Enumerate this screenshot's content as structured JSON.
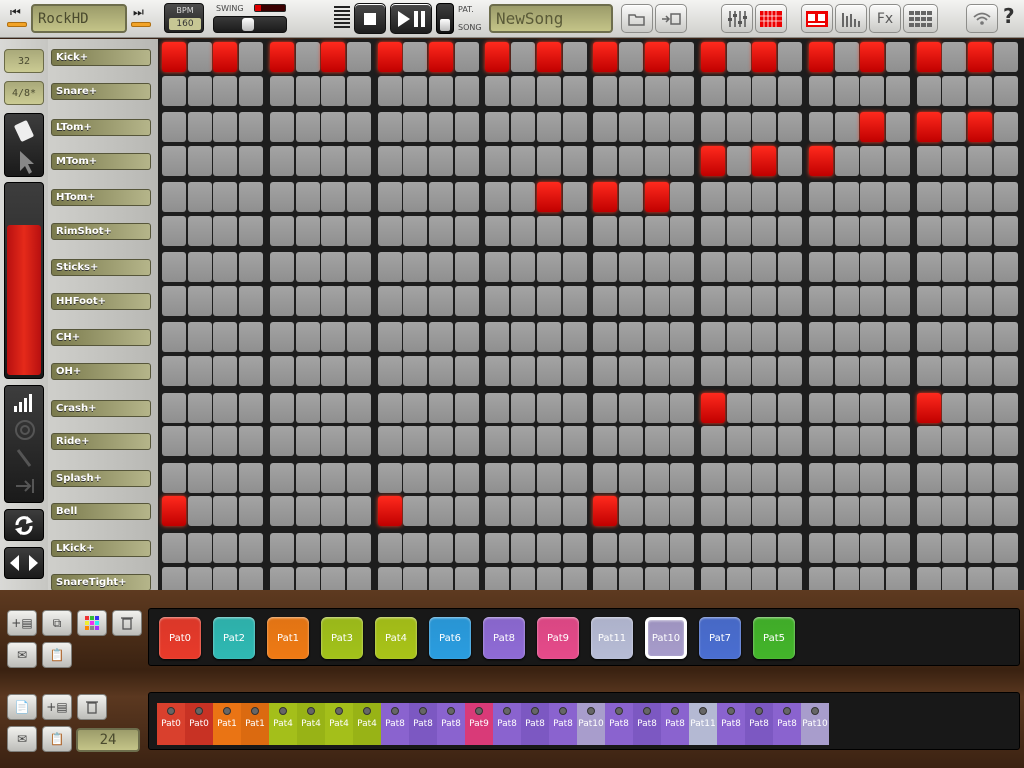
{
  "song_name": "RockHD",
  "bpm_label": "BPM",
  "bpm_value": "160",
  "swing_label": "SWING",
  "pat_label": "PAT.",
  "song_label": "SONG",
  "pattern_name": "NewSong",
  "steps_value": "32",
  "time_signature": "4/8*",
  "song_length": "24",
  "help_label": "?",
  "fx_label": "Fx",
  "instruments": [
    "Kick+",
    "Snare+",
    "LTom+",
    "MTom+",
    "HTom+",
    "RimShot+",
    "Sticks+",
    "HHFoot+",
    "CH+",
    "OH+",
    "Crash+",
    "Ride+",
    "Splash+",
    "Bell",
    "LKick+",
    "SnareTight+"
  ],
  "active_steps": [
    [
      0,
      2,
      4,
      6,
      8,
      10,
      12,
      14,
      16,
      18,
      20,
      22,
      24,
      26,
      28,
      30
    ],
    [],
    [
      26,
      28,
      30
    ],
    [
      20,
      22,
      24
    ],
    [
      14,
      16,
      18
    ],
    [],
    [],
    [],
    [],
    [],
    [
      20,
      28
    ],
    [],
    [],
    [
      0,
      8,
      16
    ],
    [],
    []
  ],
  "patterns": [
    {
      "label": "Pat0",
      "color": "#e83a2a"
    },
    {
      "label": "Pat2",
      "color": "#2fb9b3"
    },
    {
      "label": "Pat1",
      "color": "#ef7a14"
    },
    {
      "label": "Pat3",
      "color": "#a2c21a"
    },
    {
      "label": "Pat4",
      "color": "#a9c418"
    },
    {
      "label": "Pat6",
      "color": "#2a9de0"
    },
    {
      "label": "Pat8",
      "color": "#8f6bd6"
    },
    {
      "label": "Pat9",
      "color": "#e64a8a"
    },
    {
      "label": "Pat11",
      "color": "#b7bcd6"
    },
    {
      "label": "Pat10",
      "color": "#a79ccb",
      "selected": true
    },
    {
      "label": "Pat7",
      "color": "#4a6ed1"
    },
    {
      "label": "Pat5",
      "color": "#43b52a"
    }
  ],
  "song_sequence": [
    {
      "label": "Pat0",
      "color": "#d9402d"
    },
    {
      "label": "Pat0",
      "color": "#c83224"
    },
    {
      "label": "Pat1",
      "color": "#ea7414"
    },
    {
      "label": "Pat1",
      "color": "#db6a10"
    },
    {
      "label": "Pat4",
      "color": "#a4bf1a"
    },
    {
      "label": "Pat4",
      "color": "#98b316"
    },
    {
      "label": "Pat4",
      "color": "#a4bf1a"
    },
    {
      "label": "Pat4",
      "color": "#98b316"
    },
    {
      "label": "Pat8",
      "color": "#8a63cf"
    },
    {
      "label": "Pat8",
      "color": "#7c58c2"
    },
    {
      "label": "Pat8",
      "color": "#8a63cf"
    },
    {
      "label": "Pat9",
      "color": "#d93a78"
    },
    {
      "label": "Pat8",
      "color": "#8a63cf"
    },
    {
      "label": "Pat8",
      "color": "#7c58c2"
    },
    {
      "label": "Pat8",
      "color": "#8a63cf"
    },
    {
      "label": "Pat10",
      "color": "#a89dcc"
    },
    {
      "label": "Pat8",
      "color": "#8a63cf"
    },
    {
      "label": "Pat8",
      "color": "#7c58c2"
    },
    {
      "label": "Pat8",
      "color": "#8a63cf"
    },
    {
      "label": "Pat11",
      "color": "#b4b9d3"
    },
    {
      "label": "Pat8",
      "color": "#8a63cf"
    },
    {
      "label": "Pat8",
      "color": "#7c58c2"
    },
    {
      "label": "Pat8",
      "color": "#8a63cf"
    },
    {
      "label": "Pat10",
      "color": "#a89dcc"
    }
  ],
  "icons": {
    "prev_song": "skip-back-icon",
    "next_song": "skip-forward-icon",
    "stop": "stop-icon",
    "play_pause": "play-pause-icon",
    "open": "folder-open-icon",
    "save": "save-icon",
    "mixer": "mixer-icon",
    "grid_view": "grid-view-icon",
    "machine": "drum-machine-icon",
    "bars": "level-bars-icon",
    "pattern_list": "pattern-list-icon",
    "wifi": "wifi-icon",
    "eraser": "eraser-icon",
    "pointer": "pointer-icon",
    "velocity": "velocity-bars-icon",
    "loop": "loop-icon"
  }
}
